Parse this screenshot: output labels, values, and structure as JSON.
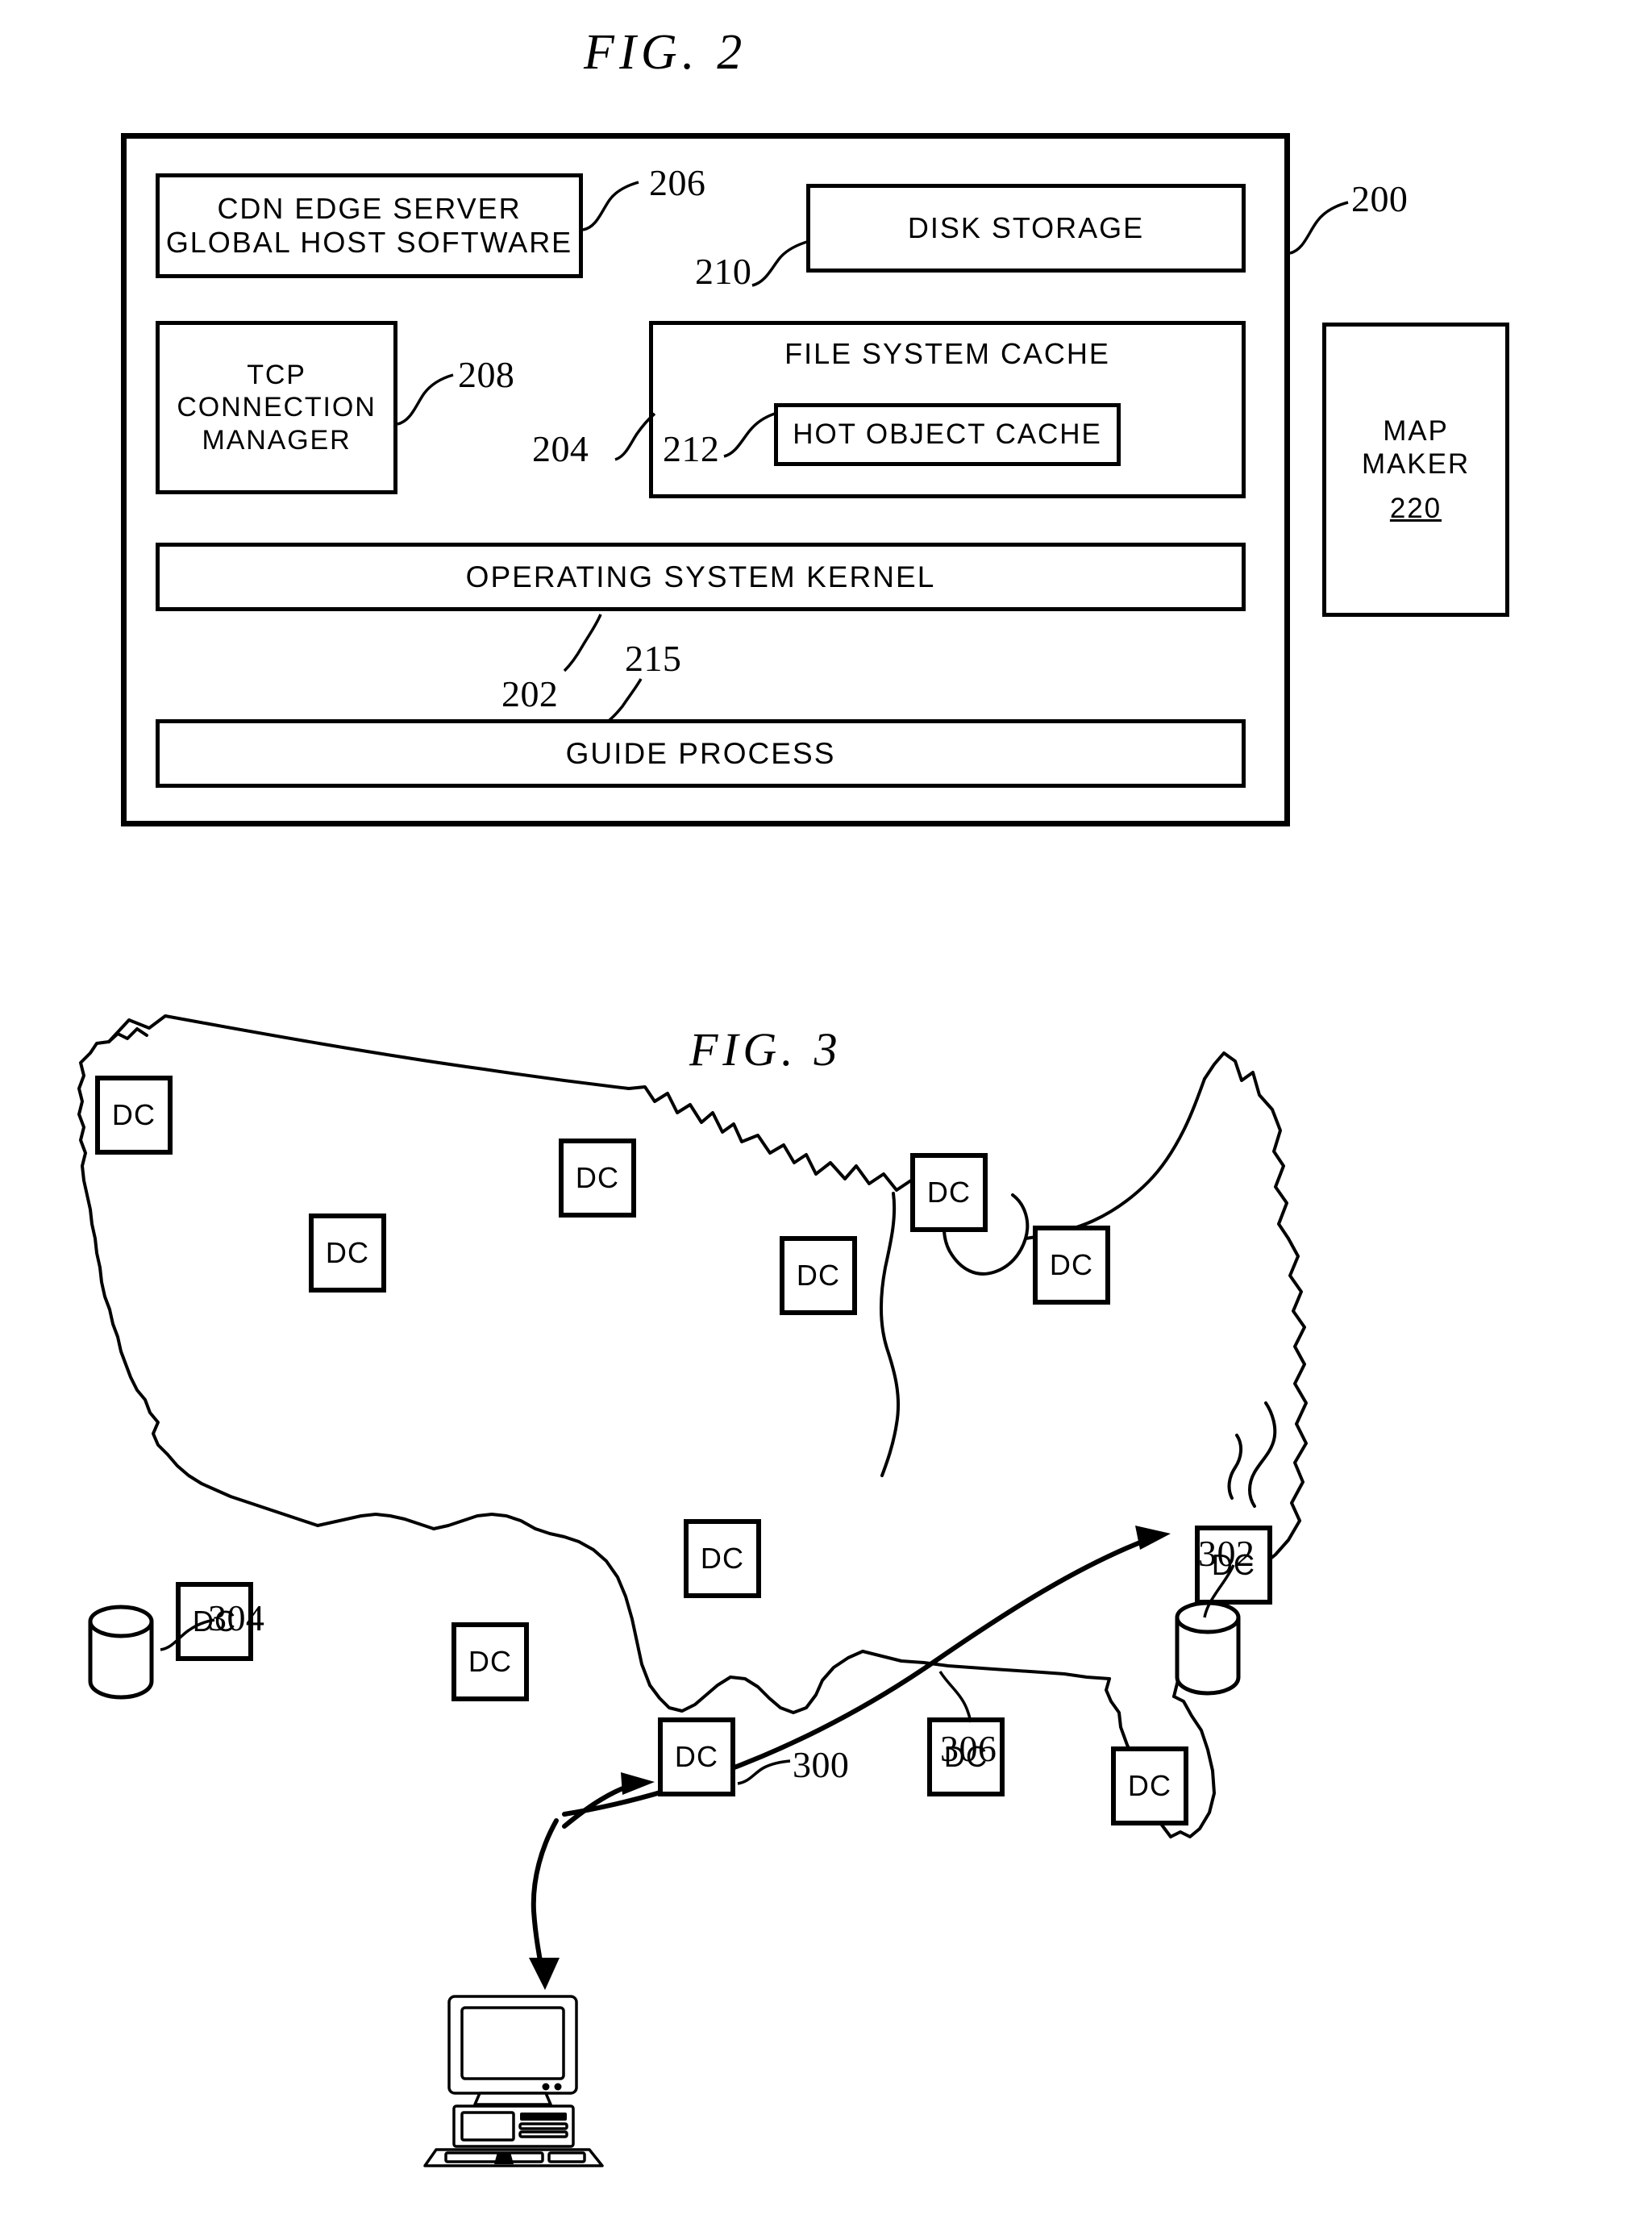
{
  "figures": {
    "fig2": {
      "title": "FIG.  2",
      "frame_ref": "200",
      "blocks": {
        "cdn_edge_server": {
          "line1": "CDN EDGE SERVER",
          "line2": "GLOBAL HOST SOFTWARE",
          "ref": "206"
        },
        "tcp_connection_manager": {
          "line1": "TCP",
          "line2": "CONNECTION",
          "line3": "MANAGER",
          "ref": "208"
        },
        "disk_storage": {
          "label": "DISK STORAGE",
          "ref": "210"
        },
        "file_system_cache": {
          "label": "FILE SYSTEM CACHE",
          "ref": "204"
        },
        "hot_object_cache": {
          "label": "HOT OBJECT CACHE",
          "ref": "212"
        },
        "operating_system_kernel": {
          "label": "OPERATING SYSTEM KERNEL",
          "ref": "202"
        },
        "guide_process": {
          "label": "GUIDE PROCESS",
          "ref": "215"
        },
        "map_maker": {
          "line1": "MAP",
          "line2": "MAKER",
          "number": "220"
        }
      }
    },
    "fig3": {
      "title": "FIG.  3",
      "node_label": "DC",
      "data_centers": [
        {
          "id": "dc-seattle",
          "label": "DC"
        },
        {
          "id": "dc-montana",
          "label": "DC"
        },
        {
          "id": "dc-minneapolis",
          "label": "DC"
        },
        {
          "id": "dc-chicago",
          "label": "DC"
        },
        {
          "id": "dc-utah",
          "label": "DC"
        },
        {
          "id": "dc-kansas",
          "label": "DC"
        },
        {
          "id": "dc-missouri",
          "label": "DC"
        },
        {
          "id": "dc-losangeles",
          "label": "DC"
        },
        {
          "id": "dc-phoenix",
          "label": "DC"
        },
        {
          "id": "dc-dallas",
          "label": "DC"
        },
        {
          "id": "dc-atlanta",
          "label": "DC"
        },
        {
          "id": "dc-florida",
          "label": "DC"
        },
        {
          "id": "dc-virginia",
          "label": "DC"
        }
      ],
      "refs": {
        "origin_server": "302",
        "west_storage": "304",
        "target_dc": "300",
        "transfer_arrow": "306"
      }
    }
  }
}
